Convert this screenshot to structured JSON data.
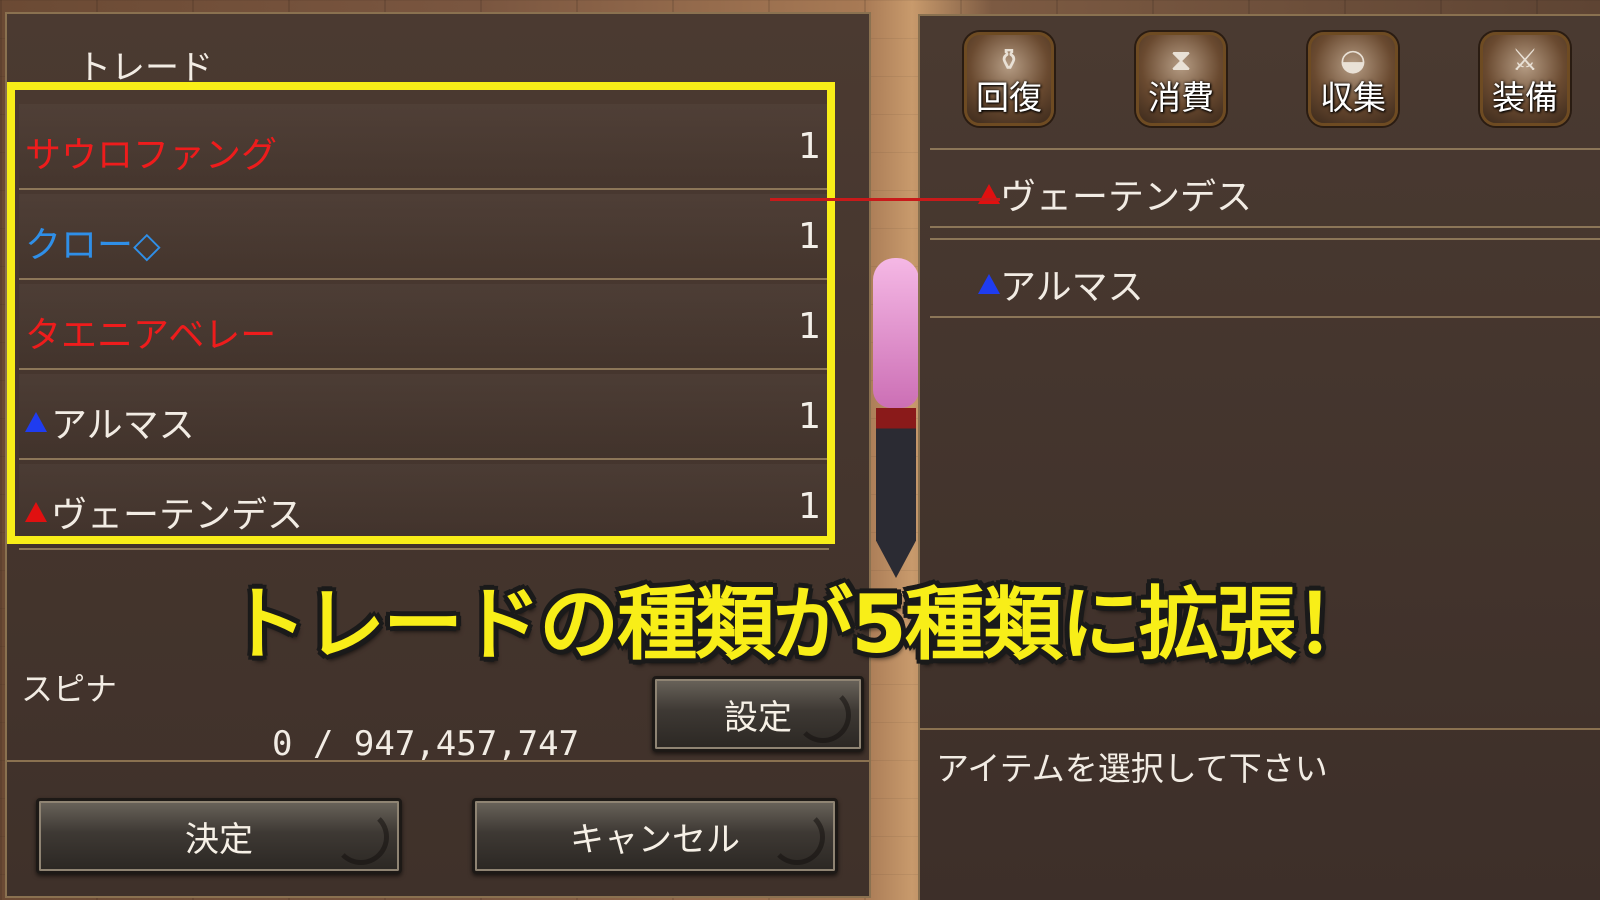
{
  "trade_panel": {
    "title": "トレード",
    "items": [
      {
        "name": "サウロファング",
        "qty": "1",
        "color": "#ee1c1c",
        "marker": "none"
      },
      {
        "name": "クロー◇",
        "qty": "1",
        "color": "#2f8fe8",
        "marker": "none"
      },
      {
        "name": "タエニアベレー",
        "qty": "1",
        "color": "#ee1c1c",
        "marker": "none"
      },
      {
        "name": "アルマス",
        "qty": "1",
        "color": "#f2ece4",
        "marker": "blue-triangle"
      },
      {
        "name": "ヴェーテンデス",
        "qty": "1",
        "color": "#f2ece4",
        "marker": "red-triangle"
      }
    ],
    "currency_label": "スピナ",
    "currency_value": "0 / 947,457,747",
    "set_button": "設定",
    "confirm_button": "決定",
    "cancel_button": "キャンセル",
    "highlight_color": "#f8ee18"
  },
  "inventory_panel": {
    "tabs": [
      {
        "label": "回復",
        "icon": "potion-icon"
      },
      {
        "label": "消費",
        "icon": "hourglass-icon"
      },
      {
        "label": "収集",
        "icon": "bread-icon"
      },
      {
        "label": "装備",
        "icon": "sword-icon"
      }
    ],
    "items": [
      {
        "name": "ヴェーテンデス",
        "marker": "red-triangle"
      },
      {
        "name": "アルマス",
        "marker": "blue-triangle"
      }
    ],
    "message": "アイテムを選択して下さい"
  },
  "banner": {
    "text": "トレードの種類が5種類に拡張！",
    "color": "#f8ee18"
  }
}
